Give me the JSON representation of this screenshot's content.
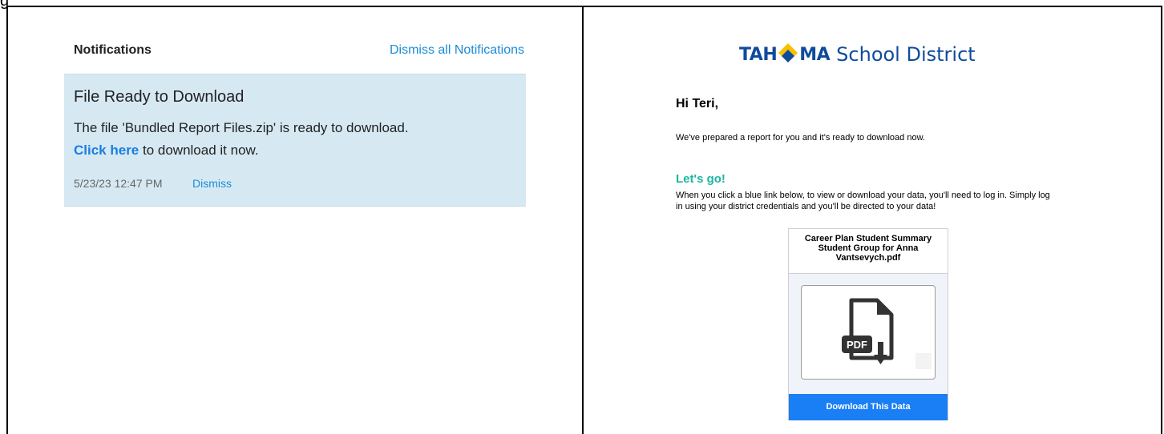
{
  "top_label": "g",
  "notifications": {
    "title": "Notifications",
    "dismiss_all": "Dismiss all Notifications",
    "card": {
      "title": "File Ready to Download",
      "line1": "The file 'Bundled Report Files.zip' is ready to download.",
      "link": "Click here",
      "line2_rest": " to download it now.",
      "timestamp": "5/23/23 12:47 PM",
      "dismiss": "Dismiss"
    }
  },
  "email": {
    "logo_bold_left": "TAH",
    "logo_bold_right": "MA",
    "logo_rest": "School District",
    "greeting": "Hi Teri,",
    "intro": "We've prepared a report for you and it's ready to download now.",
    "lets_go": "Let's go!",
    "instructions": "When you click a blue link below, to view or download your data, you'll need to log in. Simply log in using your district credentials and you'll be directed to your data!",
    "file_name": "Career Plan Student Summary Student Group for Anna Vantsevych.pdf",
    "pdf_badge": "PDF",
    "download_button": "Download This Data"
  },
  "colors": {
    "link_blue": "#1a8cd8",
    "card_bg": "#d6e9f3",
    "logo_blue": "#0f4b9c",
    "logo_yellow": "#f6c200",
    "accent_green": "#1db6a1",
    "button_blue": "#1a7ef4"
  }
}
